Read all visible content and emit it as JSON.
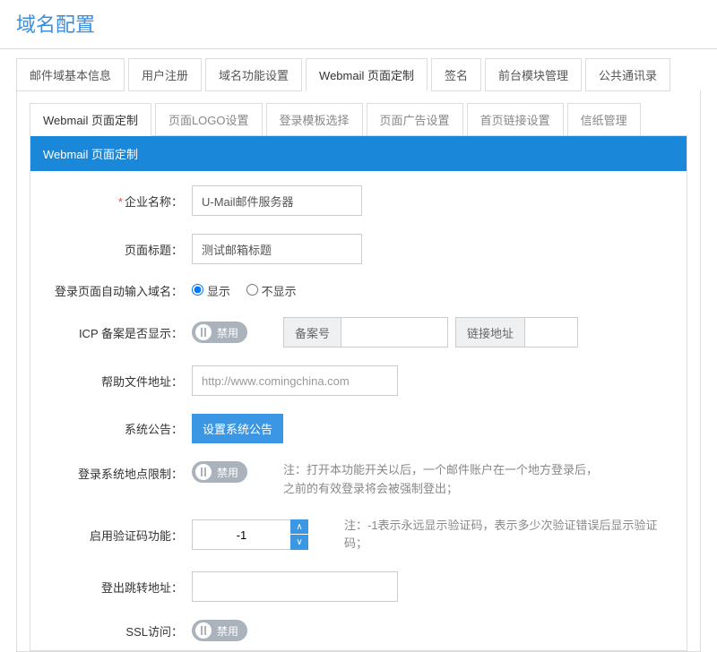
{
  "page_title": "域名配置",
  "outer_tabs": [
    "邮件域基本信息",
    "用户注册",
    "域名功能设置",
    "Webmail 页面定制",
    "签名",
    "前台模块管理",
    "公共通讯录"
  ],
  "outer_active_index": 3,
  "inner_tabs": [
    "Webmail 页面定制",
    "页面LOGO设置",
    "登录模板选择",
    "页面广告设置",
    "首页链接设置",
    "信纸管理"
  ],
  "inner_active_index": 0,
  "panel_title": "Webmail 页面定制",
  "labels": {
    "company": "企业名称：",
    "page_title": "页面标题：",
    "auto_domain": "登录页面自动输入域名：",
    "icp": "ICP 备案是否显示：",
    "help_url": "帮助文件地址：",
    "notice": "系统公告：",
    "login_limit": "登录系统地点限制：",
    "captcha": "启用验证码功能：",
    "logout_url": "登出跳转地址：",
    "ssl": "SSL访问："
  },
  "values": {
    "company": "U-Mail邮件服务器",
    "page_title": "测试邮箱标题",
    "help_url": "http://www.comingchina.com",
    "captcha": "-1",
    "logout_url": ""
  },
  "radio": {
    "show": "显示",
    "hide": "不显示"
  },
  "toggle_disable": "禁用",
  "icp_addon": {
    "label1": "备案号",
    "label2": "链接地址"
  },
  "notice_button": "设置系统公告",
  "notes": {
    "login_limit": "注：打开本功能开关以后，一个邮件账户在一个地方登录后，之前的有效登录将会被强制登出；",
    "captcha": "注：-1表示永远显示验证码，表示多少次验证错误后显示验证码；"
  }
}
